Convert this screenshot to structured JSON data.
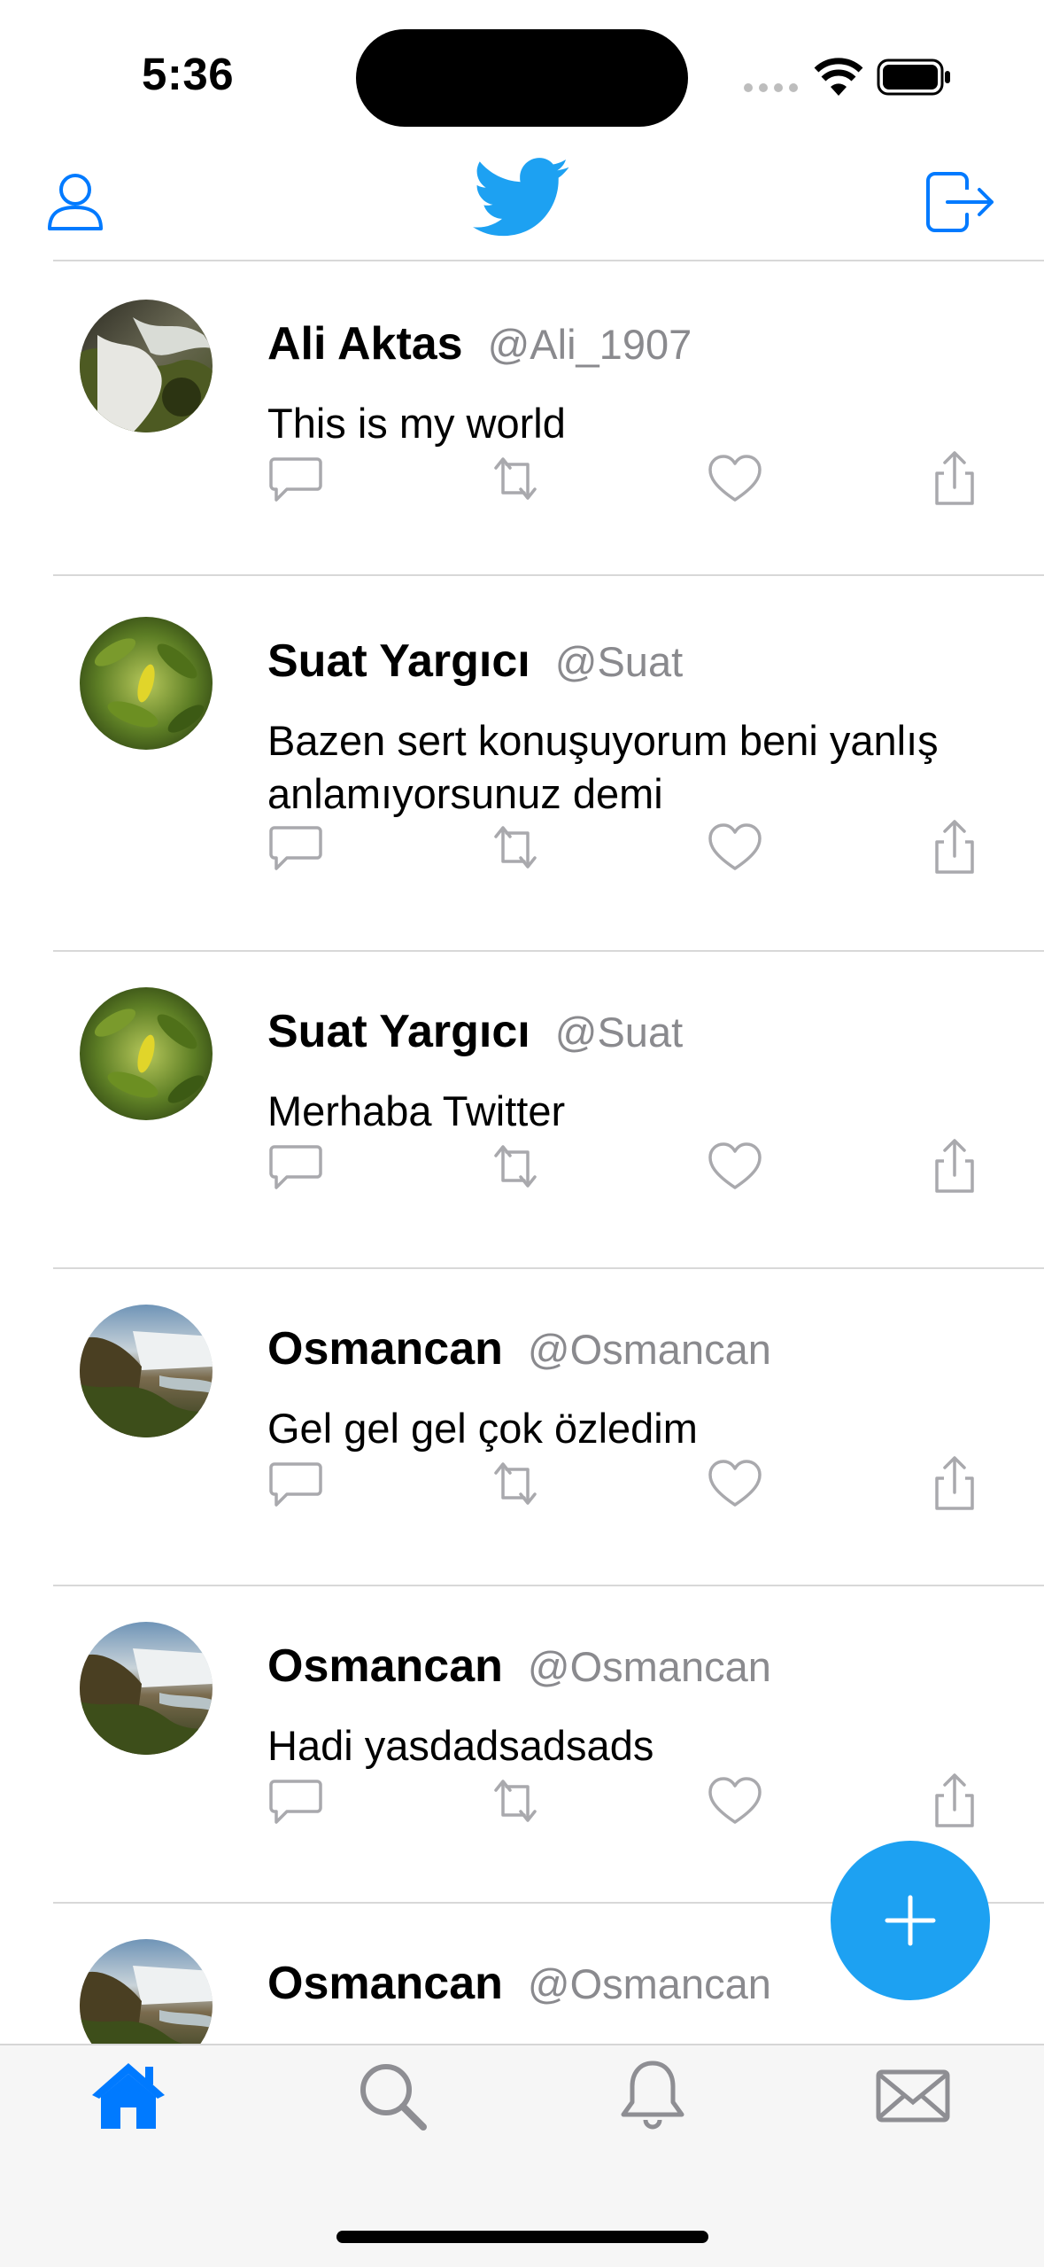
{
  "status_bar": {
    "time": "5:36"
  },
  "colors": {
    "accent": "#1da1f2",
    "ios_blue": "#007aff",
    "handle_gray": "#8a8a8e",
    "icon_gray": "#a9a9ad"
  },
  "nav": {
    "left_icon": "person-icon",
    "center_icon": "twitter-bird-icon",
    "right_icon": "logout-icon"
  },
  "tweets": [
    {
      "name": "Ali Aktas",
      "handle": "@Ali_1907",
      "text": "This is my world",
      "avatar": "waterfall-rocks"
    },
    {
      "name": "Suat Yargıcı",
      "handle": "@Suat",
      "text": "Bazen sert konuşuyorum beni yanlış anlamıyorsunuz demi",
      "avatar": "green-leaves"
    },
    {
      "name": "Suat Yargıcı",
      "handle": "@Suat",
      "text": "Merhaba Twitter",
      "avatar": "green-leaves"
    },
    {
      "name": "Osmancan",
      "handle": "@Osmancan",
      "text": "Gel gel gel çok özledim",
      "avatar": "waterfall-coast"
    },
    {
      "name": "Osmancan",
      "handle": "@Osmancan",
      "text": "Hadi yasdadsadsads",
      "avatar": "waterfall-coast"
    },
    {
      "name": "Osmancan",
      "handle": "@Osmancan",
      "text": "",
      "avatar": "waterfall-coast"
    }
  ],
  "tabs": [
    {
      "icon": "home-icon",
      "selected": true
    },
    {
      "icon": "search-icon",
      "selected": false
    },
    {
      "icon": "bell-icon",
      "selected": false
    },
    {
      "icon": "mail-icon",
      "selected": false
    }
  ],
  "fab": {
    "icon": "plus-icon"
  }
}
